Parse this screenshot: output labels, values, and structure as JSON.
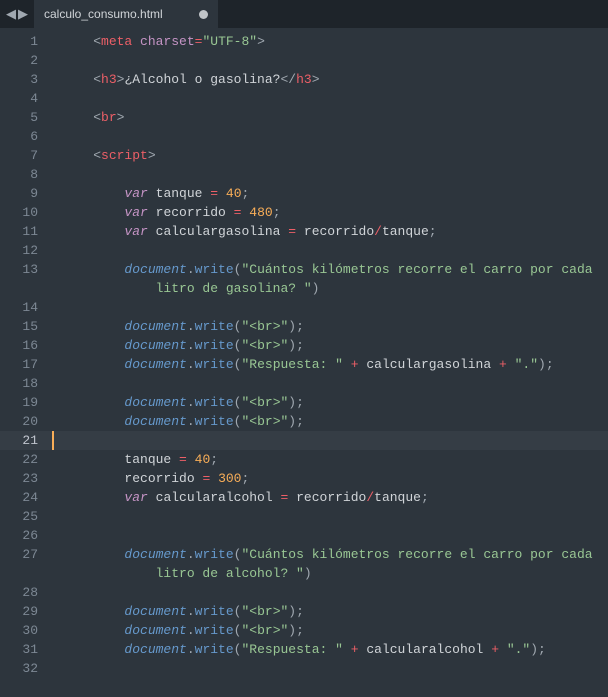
{
  "tab": {
    "filename": "calculo_consumo.html",
    "dirty": true
  },
  "nav": {
    "back_icon": "◀",
    "forward_icon": "▶"
  },
  "gutter": [
    "1",
    "2",
    "3",
    "4",
    "5",
    "6",
    "7",
    "8",
    "9",
    "10",
    "11",
    "12",
    "13",
    "",
    "14",
    "15",
    "16",
    "17",
    "18",
    "19",
    "20",
    "21",
    "22",
    "23",
    "24",
    "25",
    "26",
    "27",
    "",
    "28",
    "29",
    "30",
    "31",
    "32",
    ""
  ],
  "active_line_index": 21,
  "code_tokens": [
    [
      [
        "punc",
        "    <"
      ],
      [
        "tag",
        "meta"
      ],
      [
        "punc",
        " "
      ],
      [
        "attr",
        "charset"
      ],
      [
        "op",
        "="
      ],
      [
        "str",
        "\"UTF-8\""
      ],
      [
        "punc",
        ">"
      ]
    ],
    [],
    [
      [
        "punc",
        "    <"
      ],
      [
        "tag",
        "h3"
      ],
      [
        "punc",
        ">"
      ],
      [
        "txt",
        "¿Alcohol o gasolina?"
      ],
      [
        "punc",
        "</"
      ],
      [
        "tag",
        "h3"
      ],
      [
        "punc",
        ">"
      ]
    ],
    [],
    [
      [
        "punc",
        "    <"
      ],
      [
        "tag",
        "br"
      ],
      [
        "punc",
        ">"
      ]
    ],
    [],
    [
      [
        "punc",
        "    <"
      ],
      [
        "tag",
        "script"
      ],
      [
        "punc",
        ">"
      ]
    ],
    [],
    [
      [
        "txt",
        "        "
      ],
      [
        "kw",
        "var"
      ],
      [
        "txt",
        " "
      ],
      [
        "var",
        "tanque"
      ],
      [
        "txt",
        " "
      ],
      [
        "op",
        "="
      ],
      [
        "txt",
        " "
      ],
      [
        "num",
        "40"
      ],
      [
        "punc",
        ";"
      ]
    ],
    [
      [
        "txt",
        "        "
      ],
      [
        "kw",
        "var"
      ],
      [
        "txt",
        " "
      ],
      [
        "var",
        "recorrido"
      ],
      [
        "txt",
        " "
      ],
      [
        "op",
        "="
      ],
      [
        "txt",
        " "
      ],
      [
        "num",
        "480"
      ],
      [
        "punc",
        ";"
      ]
    ],
    [
      [
        "txt",
        "        "
      ],
      [
        "kw",
        "var"
      ],
      [
        "txt",
        " "
      ],
      [
        "var",
        "calculargasolina"
      ],
      [
        "txt",
        " "
      ],
      [
        "op",
        "="
      ],
      [
        "txt",
        " "
      ],
      [
        "var",
        "recorrido"
      ],
      [
        "op",
        "/"
      ],
      [
        "var",
        "tanque"
      ],
      [
        "punc",
        ";"
      ]
    ],
    [],
    [
      [
        "txt",
        "        "
      ],
      [
        "obj",
        "document"
      ],
      [
        "punc",
        "."
      ],
      [
        "method",
        "write"
      ],
      [
        "punc",
        "("
      ],
      [
        "str",
        "\"Cuántos kilómetros recorre el carro por cada"
      ]
    ],
    [
      [
        "txt",
        "            "
      ],
      [
        "str",
        "litro de gasolina? \""
      ],
      [
        "punc",
        ")"
      ]
    ],
    [],
    [
      [
        "txt",
        "        "
      ],
      [
        "obj",
        "document"
      ],
      [
        "punc",
        "."
      ],
      [
        "method",
        "write"
      ],
      [
        "punc",
        "("
      ],
      [
        "str",
        "\"<br>\""
      ],
      [
        "punc",
        ");"
      ]
    ],
    [
      [
        "txt",
        "        "
      ],
      [
        "obj",
        "document"
      ],
      [
        "punc",
        "."
      ],
      [
        "method",
        "write"
      ],
      [
        "punc",
        "("
      ],
      [
        "str",
        "\"<br>\""
      ],
      [
        "punc",
        ");"
      ]
    ],
    [
      [
        "txt",
        "        "
      ],
      [
        "obj",
        "document"
      ],
      [
        "punc",
        "."
      ],
      [
        "method",
        "write"
      ],
      [
        "punc",
        "("
      ],
      [
        "str",
        "\"Respuesta: \""
      ],
      [
        "txt",
        " "
      ],
      [
        "op",
        "+"
      ],
      [
        "txt",
        " "
      ],
      [
        "var",
        "calculargasolina"
      ],
      [
        "txt",
        " "
      ],
      [
        "op",
        "+"
      ],
      [
        "txt",
        " "
      ],
      [
        "str",
        "\".\""
      ],
      [
        "punc",
        ");"
      ]
    ],
    [],
    [
      [
        "txt",
        "        "
      ],
      [
        "obj",
        "document"
      ],
      [
        "punc",
        "."
      ],
      [
        "method",
        "write"
      ],
      [
        "punc",
        "("
      ],
      [
        "str",
        "\"<br>\""
      ],
      [
        "punc",
        ");"
      ]
    ],
    [
      [
        "txt",
        "        "
      ],
      [
        "obj",
        "document"
      ],
      [
        "punc",
        "."
      ],
      [
        "method",
        "write"
      ],
      [
        "punc",
        "("
      ],
      [
        "str",
        "\"<br>\""
      ],
      [
        "punc",
        ");"
      ]
    ],
    [],
    [
      [
        "txt",
        "        "
      ],
      [
        "var",
        "tanque"
      ],
      [
        "txt",
        " "
      ],
      [
        "op",
        "="
      ],
      [
        "txt",
        " "
      ],
      [
        "num",
        "40"
      ],
      [
        "punc",
        ";"
      ]
    ],
    [
      [
        "txt",
        "        "
      ],
      [
        "var",
        "recorrido"
      ],
      [
        "txt",
        " "
      ],
      [
        "op",
        "="
      ],
      [
        "txt",
        " "
      ],
      [
        "num",
        "300"
      ],
      [
        "punc",
        ";"
      ]
    ],
    [
      [
        "txt",
        "        "
      ],
      [
        "kw",
        "var"
      ],
      [
        "txt",
        " "
      ],
      [
        "var",
        "calcularalcohol"
      ],
      [
        "txt",
        " "
      ],
      [
        "op",
        "="
      ],
      [
        "txt",
        " "
      ],
      [
        "var",
        "recorrido"
      ],
      [
        "op",
        "/"
      ],
      [
        "var",
        "tanque"
      ],
      [
        "punc",
        ";"
      ]
    ],
    [],
    [],
    [
      [
        "txt",
        "        "
      ],
      [
        "obj",
        "document"
      ],
      [
        "punc",
        "."
      ],
      [
        "method",
        "write"
      ],
      [
        "punc",
        "("
      ],
      [
        "str",
        "\"Cuántos kilómetros recorre el carro por cada"
      ]
    ],
    [
      [
        "txt",
        "            "
      ],
      [
        "str",
        "litro de alcohol? \""
      ],
      [
        "punc",
        ")"
      ]
    ],
    [],
    [
      [
        "txt",
        "        "
      ],
      [
        "obj",
        "document"
      ],
      [
        "punc",
        "."
      ],
      [
        "method",
        "write"
      ],
      [
        "punc",
        "("
      ],
      [
        "str",
        "\"<br>\""
      ],
      [
        "punc",
        ");"
      ]
    ],
    [
      [
        "txt",
        "        "
      ],
      [
        "obj",
        "document"
      ],
      [
        "punc",
        "."
      ],
      [
        "method",
        "write"
      ],
      [
        "punc",
        "("
      ],
      [
        "str",
        "\"<br>\""
      ],
      [
        "punc",
        ");"
      ]
    ],
    [
      [
        "txt",
        "        "
      ],
      [
        "obj",
        "document"
      ],
      [
        "punc",
        "."
      ],
      [
        "method",
        "write"
      ],
      [
        "punc",
        "("
      ],
      [
        "str",
        "\"Respuesta: \""
      ],
      [
        "txt",
        " "
      ],
      [
        "op",
        "+"
      ],
      [
        "txt",
        " "
      ],
      [
        "var",
        "calcularalcohol"
      ],
      [
        "txt",
        " "
      ],
      [
        "op",
        "+"
      ],
      [
        "txt",
        " "
      ],
      [
        "str",
        "\".\""
      ],
      [
        "punc",
        ");"
      ]
    ],
    []
  ]
}
